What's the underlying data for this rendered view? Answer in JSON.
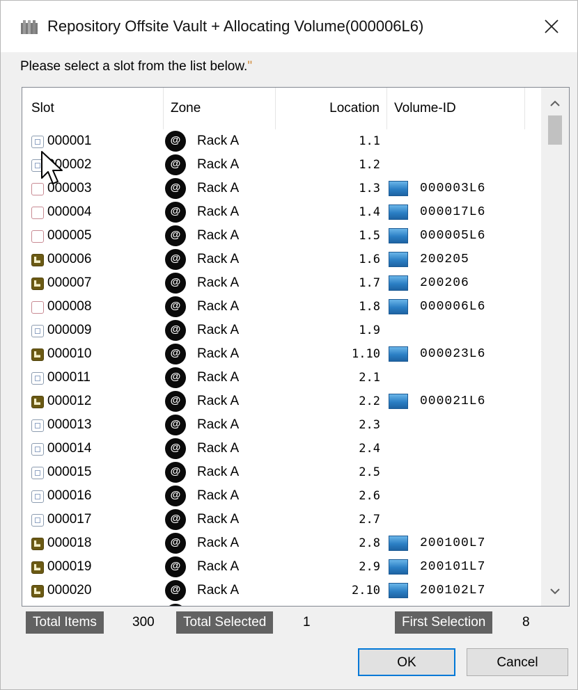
{
  "window": {
    "title": "Repository Offsite Vault + Allocating Volume(000006L6)",
    "close_glyph": "✕",
    "app_icon": "vault-icon"
  },
  "prompt": {
    "text": "Please select a slot from the list below.",
    "mark": "\""
  },
  "table": {
    "columns": {
      "slot": "Slot",
      "zone": "Zone",
      "location": "Location",
      "volume": "Volume-ID"
    },
    "rows": [
      {
        "slot": "000001",
        "slot_state": "empty",
        "zone": "Rack A",
        "location": "1.1",
        "volume": ""
      },
      {
        "slot": "000002",
        "slot_state": "empty",
        "zone": "Rack A",
        "location": "1.2",
        "volume": ""
      },
      {
        "slot": "000003",
        "slot_state": "pink",
        "zone": "Rack A",
        "location": "1.3",
        "volume": "000003L6"
      },
      {
        "slot": "000004",
        "slot_state": "pink",
        "zone": "Rack A",
        "location": "1.4",
        "volume": "000017L6"
      },
      {
        "slot": "000005",
        "slot_state": "pink",
        "zone": "Rack A",
        "location": "1.5",
        "volume": "000005L6"
      },
      {
        "slot": "000006",
        "slot_state": "filled",
        "zone": "Rack A",
        "location": "1.6",
        "volume": "200205"
      },
      {
        "slot": "000007",
        "slot_state": "filled",
        "zone": "Rack A",
        "location": "1.7",
        "volume": "200206"
      },
      {
        "slot": "000008",
        "slot_state": "pink",
        "zone": "Rack A",
        "location": "1.8",
        "volume": "000006L6"
      },
      {
        "slot": "000009",
        "slot_state": "empty",
        "zone": "Rack A",
        "location": "1.9",
        "volume": ""
      },
      {
        "slot": "000010",
        "slot_state": "filled",
        "zone": "Rack A",
        "location": "1.10",
        "volume": "000023L6"
      },
      {
        "slot": "000011",
        "slot_state": "empty",
        "zone": "Rack A",
        "location": "2.1",
        "volume": ""
      },
      {
        "slot": "000012",
        "slot_state": "filled",
        "zone": "Rack A",
        "location": "2.2",
        "volume": "000021L6"
      },
      {
        "slot": "000013",
        "slot_state": "empty",
        "zone": "Rack A",
        "location": "2.3",
        "volume": ""
      },
      {
        "slot": "000014",
        "slot_state": "empty",
        "zone": "Rack A",
        "location": "2.4",
        "volume": ""
      },
      {
        "slot": "000015",
        "slot_state": "empty",
        "zone": "Rack A",
        "location": "2.5",
        "volume": ""
      },
      {
        "slot": "000016",
        "slot_state": "empty",
        "zone": "Rack A",
        "location": "2.6",
        "volume": ""
      },
      {
        "slot": "000017",
        "slot_state": "empty",
        "zone": "Rack A",
        "location": "2.7",
        "volume": ""
      },
      {
        "slot": "000018",
        "slot_state": "filled",
        "zone": "Rack A",
        "location": "2.8",
        "volume": "200100L7"
      },
      {
        "slot": "000019",
        "slot_state": "filled",
        "zone": "Rack A",
        "location": "2.9",
        "volume": "200101L7"
      },
      {
        "slot": "000020",
        "slot_state": "filled",
        "zone": "Rack A",
        "location": "2.10",
        "volume": "200102L7"
      },
      {
        "slot": "",
        "slot_state": "empty",
        "zone": "",
        "location": "",
        "volume": ""
      }
    ]
  },
  "zone_icon_glyph": "@",
  "status": {
    "total_items_label": "Total Items",
    "total_items": "300",
    "total_selected_label": "Total Selected",
    "total_selected": "1",
    "first_selection_label": "First Selection",
    "first_selection": "8"
  },
  "buttons": {
    "ok": "OK",
    "cancel": "Cancel"
  },
  "colors": {
    "badge_bg": "#626262",
    "ok_border": "#0078d7",
    "volume_icon": "#2b7fc4",
    "filled_slot": "#6b5a14"
  }
}
